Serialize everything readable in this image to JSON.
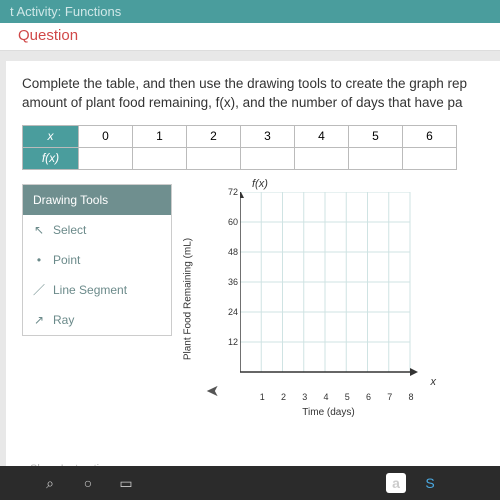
{
  "header": {
    "title": "t Activity: Functions"
  },
  "question_bar": {
    "label": "Question"
  },
  "instruction": {
    "line1": "Complete the table, and then use the drawing tools to create the graph rep",
    "line2": "amount of plant food remaining, f(x), and the number of days that have pa"
  },
  "table": {
    "row_x_label": "x",
    "row_fx_label": "f(x)",
    "x_values": [
      "0",
      "1",
      "2",
      "3",
      "4",
      "5",
      "6"
    ],
    "fx_values": [
      "",
      "",
      "",
      "",
      "",
      "",
      ""
    ]
  },
  "tools": {
    "title": "Drawing Tools",
    "items": [
      {
        "icon": "cursor-icon",
        "label": "Select"
      },
      {
        "icon": "point-icon",
        "label": "Point"
      },
      {
        "icon": "segment-icon",
        "label": "Line Segment"
      },
      {
        "icon": "ray-icon",
        "label": "Ray"
      }
    ]
  },
  "chart_data": {
    "type": "scatter",
    "title": "",
    "fx_symbol": "f(x)",
    "x_symbol": "x",
    "xlabel": "Time (days)",
    "ylabel": "Plant Food Remaining (mL)",
    "xlim": [
      0,
      8
    ],
    "ylim": [
      0,
      72
    ],
    "x_ticks": [
      1,
      2,
      3,
      4,
      5,
      6,
      7,
      8
    ],
    "y_ticks": [
      12,
      24,
      36,
      48,
      60,
      72
    ],
    "series": []
  },
  "footer": {
    "show_instructions": "Show Instructions"
  },
  "taskbar": {
    "icons": [
      "search-icon",
      "cortana-icon",
      "taskview-icon",
      "amazon-icon",
      "skype-icon"
    ]
  }
}
